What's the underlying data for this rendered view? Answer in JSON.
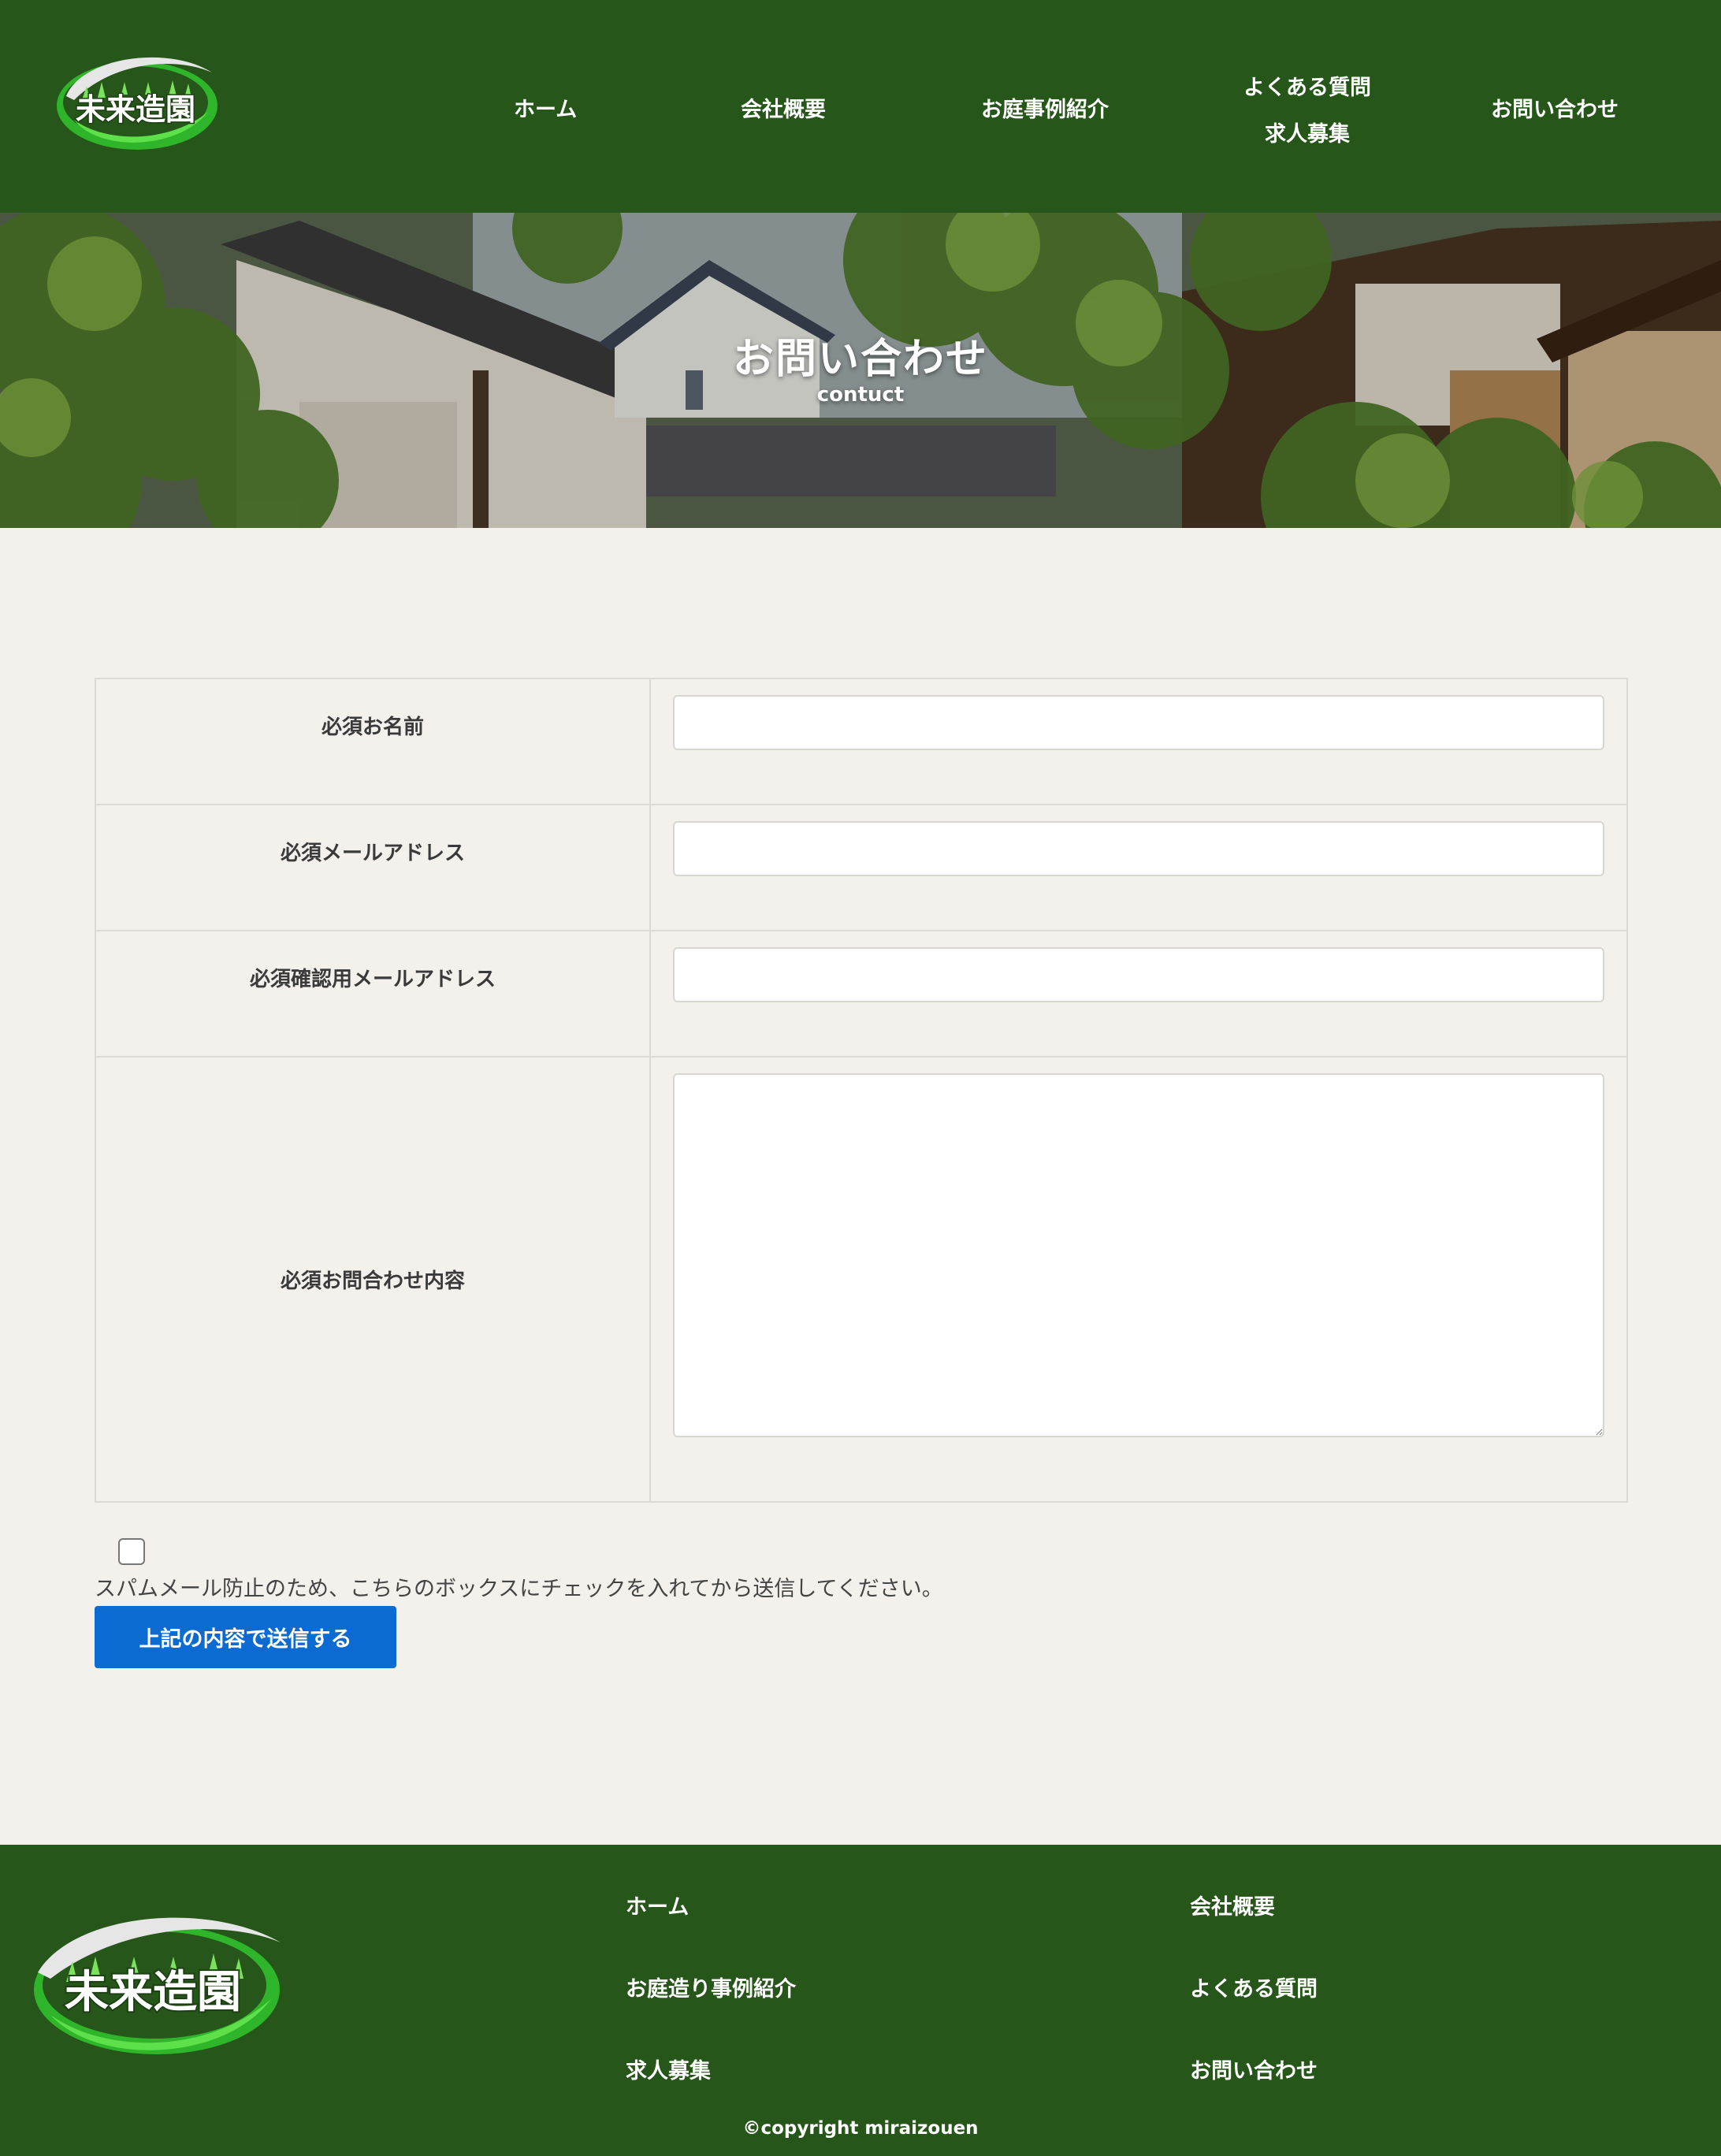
{
  "brand": {
    "logo_text": "未来造園",
    "primary_color": "#26561a",
    "accent_color": "#0c6bd3"
  },
  "nav": {
    "home": "ホーム",
    "company": "会社概要",
    "cases": "お庭事例紹介",
    "faq": "よくある質問",
    "recruit": "求人募集",
    "contact": "お問い合わせ"
  },
  "hero": {
    "title": "お問い合わせ",
    "subtitle": "contuct"
  },
  "form": {
    "fields": [
      {
        "label": "必須お名前",
        "value": "",
        "placeholder": ""
      },
      {
        "label": "必須メールアドレス",
        "value": "",
        "placeholder": ""
      },
      {
        "label": "必須確認用メールアドレス",
        "value": "",
        "placeholder": ""
      },
      {
        "label": "必須お問合わせ内容",
        "value": "",
        "placeholder": ""
      }
    ],
    "spam_text": "スパムメール防止のため、こちらのボックスにチェックを入れてから送信してください。",
    "submit_label": "上記の内容で送信する"
  },
  "footer": {
    "links": [
      {
        "label": "ホーム"
      },
      {
        "label": "会社概要"
      },
      {
        "label": "お庭造り事例紹介"
      },
      {
        "label": "よくある質問"
      },
      {
        "label": "求人募集"
      },
      {
        "label": "お問い合わせ"
      }
    ],
    "copyright": "©copyright miraizouen"
  }
}
